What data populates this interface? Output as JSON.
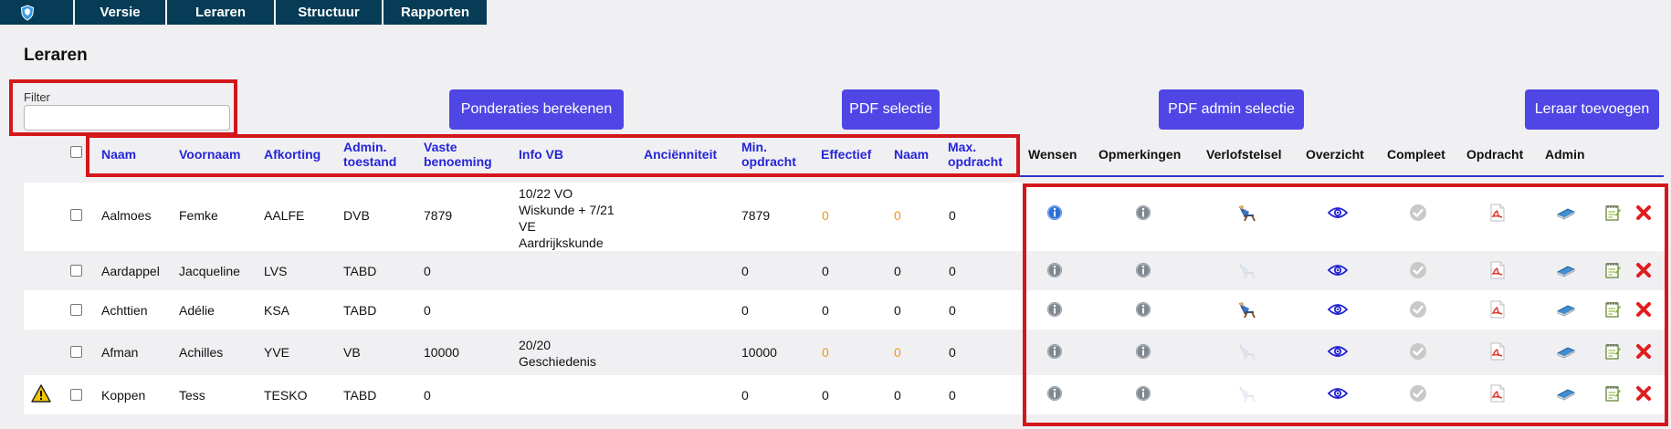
{
  "nav": {
    "items": [
      {
        "label": "Versie"
      },
      {
        "label": "Leraren"
      },
      {
        "label": "Structuur"
      },
      {
        "label": "Rapporten"
      }
    ]
  },
  "page": {
    "title": "Leraren"
  },
  "filter": {
    "label": "Filter",
    "value": ""
  },
  "buttons": {
    "ponderaties": "Ponderaties berekenen",
    "pdf_selectie": "PDF selectie",
    "pdf_admin": "PDF admin selectie",
    "add_teacher": "Leraar toevoegen"
  },
  "table": {
    "sortable_headers": {
      "naam": "Naam",
      "voornaam": "Voornaam",
      "afkorting": "Afkorting",
      "admin_toestand_1": "Admin.",
      "admin_toestand_2": "toestand",
      "vaste_benoeming_1": "Vaste",
      "vaste_benoeming_2": "benoeming",
      "info_vb": "Info VB",
      "ancienniteit": "Anciënniteit",
      "min_opdracht_1": "Min.",
      "min_opdracht_2": "opdracht",
      "effectief": "Effectief",
      "naam2": "Naam",
      "max_opdracht_1": "Max.",
      "max_opdracht_2": "opdracht"
    },
    "action_headers": {
      "wensen": "Wensen",
      "opmerkingen": "Opmerkingen",
      "verlofstelsel": "Verlofstelsel",
      "overzicht": "Overzicht",
      "compleet": "Compleet",
      "opdracht": "Opdracht",
      "admin": "Admin"
    },
    "rows": [
      {
        "naam": "Aalmoes",
        "voornaam": "Femke",
        "afkorting": "AALFE",
        "admin": "DVB",
        "vaste": "7879",
        "info1": "10/22 VO",
        "info2": "Wiskunde + 7/21",
        "info3": "VE",
        "info4": "Aardrijkskunde",
        "min": "7879",
        "effectief": "0",
        "naam2": "0",
        "max": "0",
        "warning": false,
        "wensen_active": true,
        "verlof_active": true
      },
      {
        "naam": "Aardappel",
        "voornaam": "Jacqueline",
        "afkorting": "LVS",
        "admin": "TABD",
        "vaste": "0",
        "info1": "",
        "info2": "",
        "info3": "",
        "info4": "",
        "min": "0",
        "effectief": "0",
        "naam2": "0",
        "max": "0",
        "warning": false,
        "wensen_active": false,
        "verlof_active": false
      },
      {
        "naam": "Achttien",
        "voornaam": "Adélie",
        "afkorting": "KSA",
        "admin": "TABD",
        "vaste": "0",
        "info1": "",
        "info2": "",
        "info3": "",
        "info4": "",
        "min": "0",
        "effectief": "0",
        "naam2": "0",
        "max": "0",
        "warning": false,
        "wensen_active": false,
        "verlof_active": true
      },
      {
        "naam": "Afman",
        "voornaam": "Achilles",
        "afkorting": "YVE",
        "admin": "VB",
        "vaste": "10000",
        "info1": "20/20",
        "info2": "Geschiedenis",
        "info3": "",
        "info4": "",
        "min": "10000",
        "effectief": "0",
        "naam2": "0",
        "max": "0",
        "warning": false,
        "wensen_active": false,
        "verlof_active": false
      },
      {
        "naam": "Koppen",
        "voornaam": "Tess",
        "afkorting": "TESKO",
        "admin": "TABD",
        "vaste": "0",
        "info1": "",
        "info2": "",
        "info3": "",
        "info4": "",
        "min": "0",
        "effectief": "0",
        "naam2": "0",
        "max": "0",
        "warning": true,
        "wensen_active": false,
        "verlof_active": false
      }
    ]
  },
  "colors": {
    "nav_bg": "#063c55",
    "button_bg": "#5046e5",
    "link": "#2525d8",
    "highlight": "#d3171b",
    "orange_value": "#f09418"
  },
  "icons": {
    "wensen": "info-icon",
    "opmerkingen": "info-icon",
    "verlofstelsel": "beach-chair-icon",
    "overzicht": "eye-icon",
    "compleet": "checkmark-icon",
    "opdracht": "pdf-icon",
    "admin_edit": "book-icon",
    "admin_notes": "notepad-icon",
    "admin_delete": "delete-icon",
    "warning": "warning-icon",
    "logo": "shield-logo-icon"
  }
}
